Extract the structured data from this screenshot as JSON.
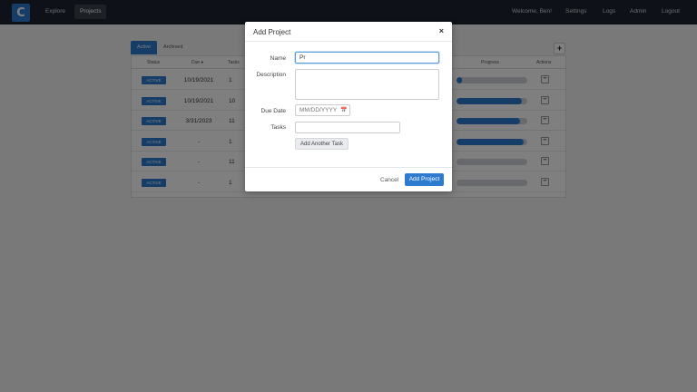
{
  "nav": {
    "logo": "C",
    "explore": "Explore",
    "projects": "Projects",
    "welcome": "Welcome, Ben!",
    "settings": "Settings",
    "logs": "Logs",
    "admin": "Admin",
    "logout": "Logout"
  },
  "tabs": {
    "active": "Active",
    "archived": "Archived"
  },
  "table": {
    "headers": {
      "status": "Status",
      "due": "Due ♦",
      "tasks": "Tasks",
      "progress": "Progress",
      "actions": "Actions"
    },
    "rows": [
      {
        "status": "ACTIVE",
        "due": "10/19/2021",
        "tasks": "1",
        "progress": 0.08
      },
      {
        "status": "ACTIVE",
        "due": "10/19/2021",
        "tasks": "10",
        "progress": 0.92
      },
      {
        "status": "ACTIVE",
        "due": "3/31/2023",
        "tasks": "11",
        "progress": 0.9
      },
      {
        "status": "ACTIVE",
        "due": "-",
        "tasks": "1",
        "progress": 0.95
      },
      {
        "status": "ACTIVE",
        "due": "-",
        "tasks": "11",
        "progress": 0.0
      },
      {
        "status": "ACTIVE",
        "due": "-",
        "tasks": "1",
        "progress": 0.0
      }
    ]
  },
  "modal": {
    "title": "Add Project",
    "close": "×",
    "name_label": "Name",
    "name_value": "Pr",
    "description_label": "Description",
    "description_value": "",
    "due_label": "Due Date",
    "due_placeholder": "MM/DD/YYYY",
    "tasks_label": "Tasks",
    "tasks_value": "",
    "add_task": "Add Another Task",
    "cancel": "Cancel",
    "submit": "Add Project"
  },
  "colors": {
    "accent": "#2d7bd1",
    "navbar": "#1c2430"
  }
}
